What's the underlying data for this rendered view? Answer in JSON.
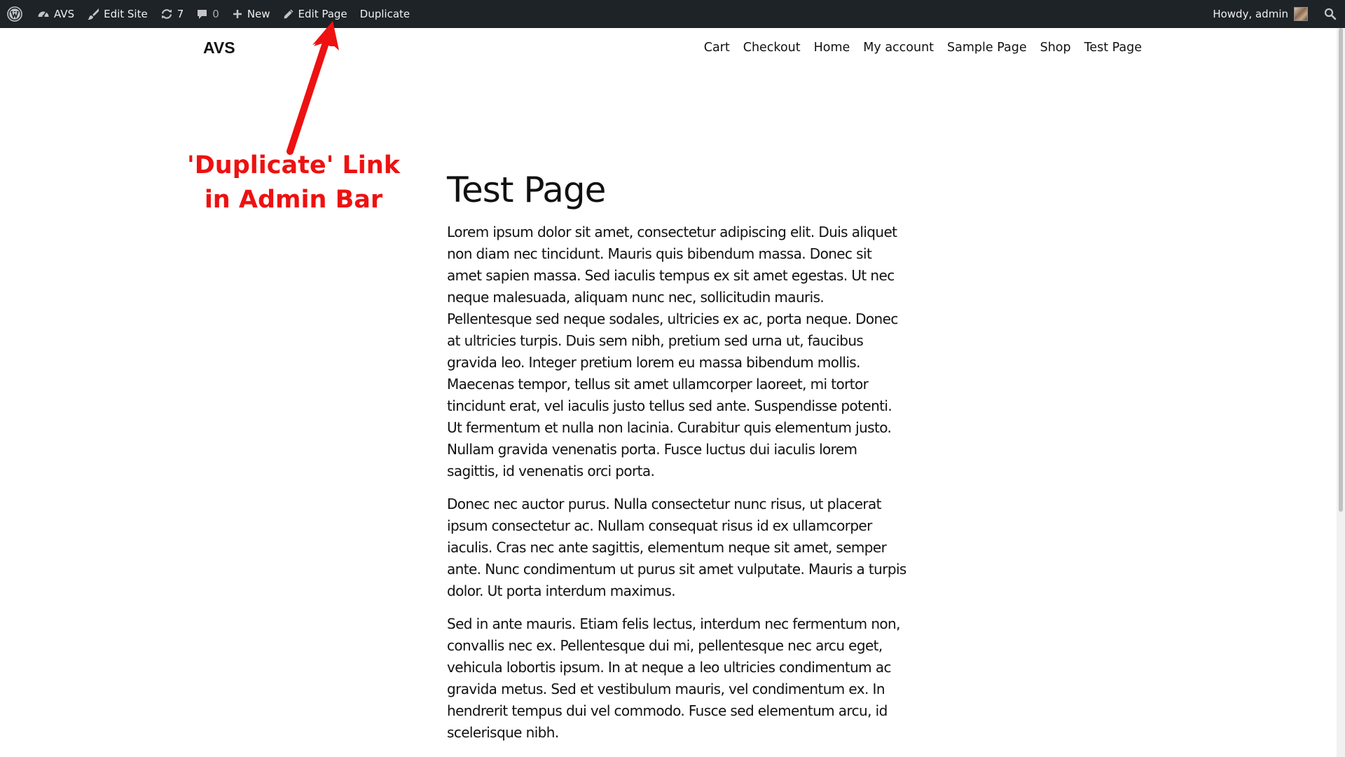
{
  "admin_bar": {
    "site_name": "AVS",
    "edit_site": "Edit Site",
    "updates_count": "7",
    "comments_count": "0",
    "new_label": "New",
    "edit_page": "Edit Page",
    "duplicate": "Duplicate",
    "greeting": "Howdy, admin"
  },
  "site": {
    "title": "AVS",
    "nav": [
      "Cart",
      "Checkout",
      "Home",
      "My account",
      "Sample Page",
      "Shop",
      "Test Page"
    ]
  },
  "page": {
    "title": "Test Page",
    "paragraphs": [
      "Lorem ipsum dolor sit amet, consectetur adipiscing elit. Duis aliquet non diam nec tincidunt. Mauris quis bibendum massa. Donec sit amet sapien massa. Sed iaculis tempus ex sit amet egestas. Ut nec neque malesuada, aliquam nunc nec, sollicitudin mauris. Pellentesque sed neque sodales, ultricies ex ac, porta neque. Donec at ultricies turpis. Duis sem nibh, pretium sed urna ut, faucibus gravida leo. Integer pretium lorem eu massa bibendum mollis. Maecenas tempor, tellus sit amet ullamcorper laoreet, mi tortor tincidunt erat, vel iaculis justo tellus sed ante. Suspendisse potenti. Ut fermentum et nulla non lacinia. Curabitur quis elementum justo. Nullam gravida venenatis porta. Fusce luctus dui iaculis lorem sagittis, id venenatis orci porta.",
      "Donec nec auctor purus. Nulla consectetur nunc risus, ut placerat ipsum consectetur ac. Nullam consequat risus id ex ullamcorper iaculis. Cras nec ante sagittis, elementum neque sit amet, semper ante. Nunc condimentum ut purus sit amet vulputate. Mauris a turpis dolor. Ut porta interdum maximus.",
      "Sed in ante mauris. Etiam felis lectus, interdum nec fermentum non, convallis nec ex. Pellentesque dui mi, pellentesque nec arcu eget, vehicula lobortis ipsum. In at neque a leo ultricies condimentum ac gravida metus. Sed et vestibulum mauris, vel condimentum ex. In hendrerit tempus dui vel commodo. Fusce sed elementum arcu, id scelerisque nibh."
    ]
  },
  "annotation": {
    "line1": "'Duplicate' Link",
    "line2": "in Admin Bar",
    "color": "#ee1111"
  },
  "colors": {
    "admin_bar_bg": "#1d2327",
    "admin_bar_text": "#f0f0f1",
    "body_text": "#111111"
  },
  "icons": {
    "wp_logo": "wordpress-logo-icon",
    "dashboard": "dashboard-gauge-icon",
    "customize": "brush-icon",
    "updates": "updates-refresh-icon",
    "comments": "comment-bubble-icon",
    "new": "plus-icon",
    "edit": "pencil-icon",
    "search": "search-icon"
  }
}
